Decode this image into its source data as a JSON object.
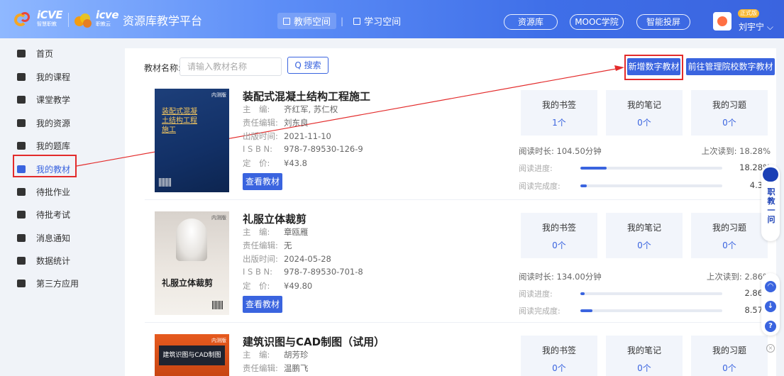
{
  "header": {
    "logo_text_1": "iCVE",
    "logo_sub_1": "智慧职教",
    "logo_text_2": "icve",
    "logo_sub_2": "职教云",
    "platform_title": "资源库教学平台",
    "tabs": [
      {
        "label": "教师空间",
        "active": true
      },
      {
        "label": "学习空间",
        "active": false
      }
    ],
    "links": [
      "资源库",
      "MOOC学院",
      "智能投屏"
    ],
    "badge": "正式版",
    "user_name": "刘宇宁 ⌵"
  },
  "sidebar": {
    "items": [
      {
        "label": "首页",
        "icon": "home-icon"
      },
      {
        "label": "我的课程",
        "icon": "course-icon"
      },
      {
        "label": "课堂教学",
        "icon": "classroom-icon"
      },
      {
        "label": "我的资源",
        "icon": "resource-icon"
      },
      {
        "label": "我的题库",
        "icon": "question-bank-icon"
      },
      {
        "label": "我的教材",
        "icon": "textbook-icon",
        "active": true
      },
      {
        "label": "待批作业",
        "icon": "homework-icon"
      },
      {
        "label": "待批考试",
        "icon": "exam-icon"
      },
      {
        "label": "消息通知",
        "icon": "message-icon"
      },
      {
        "label": "数据统计",
        "icon": "statistics-icon"
      },
      {
        "label": "第三方应用",
        "icon": "apps-icon"
      }
    ]
  },
  "filter": {
    "label": "教材名称:",
    "placeholder": "请输入教材名称",
    "search": "Q 搜索"
  },
  "actions": {
    "add_digital": "新增数字教材",
    "manage_school": "前往管理院校数字教材"
  },
  "meta_keys": {
    "editor": "主　编:",
    "resp_editor": "责任编辑:",
    "pub_time": "出版时间:",
    "isbn": "I S B N:",
    "price": "定　价:"
  },
  "stat_labels": {
    "bookmark": "我的书签",
    "notes": "我的笔记",
    "exercises": "我的习题"
  },
  "read_labels": {
    "duration": "阅读时长:",
    "last": "上次读到:",
    "progress": "阅读进度:",
    "completion": "阅读完成度:"
  },
  "view_label": "查看教材",
  "books": [
    {
      "title": "装配式混凝土结构工程施工",
      "cover_title": "装配式混凝土结构工程施工",
      "cover_tag": "内测版",
      "editor": "齐红军, 苏仁权",
      "resp_editor": "刘东良",
      "pub_time": "2021-11-10",
      "isbn": "978-7-89530-126-9",
      "price": "¥43.8",
      "bookmark": "1个",
      "notes": "0个",
      "exercises": "0个",
      "duration": "104.50分钟",
      "last": "18.28%",
      "progress_pct": "18.28%",
      "progress": 0.1828,
      "completion_pct": "4.3%",
      "completion": 0.043
    },
    {
      "title": "礼服立体裁剪",
      "cover_title": "礼服立体裁剪",
      "cover_tag": "内测版",
      "editor": "章瓯雁",
      "resp_editor": "无",
      "pub_time": "2024-05-28",
      "isbn": "978-7-89530-701-8",
      "price": "¥49.80",
      "bookmark": "0个",
      "notes": "0个",
      "exercises": "0个",
      "duration": "134.00分钟",
      "last": "2.86%",
      "progress_pct": "2.86%",
      "progress": 0.0286,
      "completion_pct": "8.57%",
      "completion": 0.0857
    },
    {
      "title": "建筑识图与CAD制图（试用）",
      "cover_title": "建筑识图与CAD制图",
      "cover_tag": "内测版",
      "editor": "胡芳珍",
      "resp_editor": "温鹏飞",
      "bookmark": "0个",
      "notes": "0个",
      "exercises": "0个"
    }
  ],
  "floating": {
    "text": "职教一问"
  },
  "colors": {
    "primary": "#3a64df",
    "highlight": "#e32b2b"
  }
}
